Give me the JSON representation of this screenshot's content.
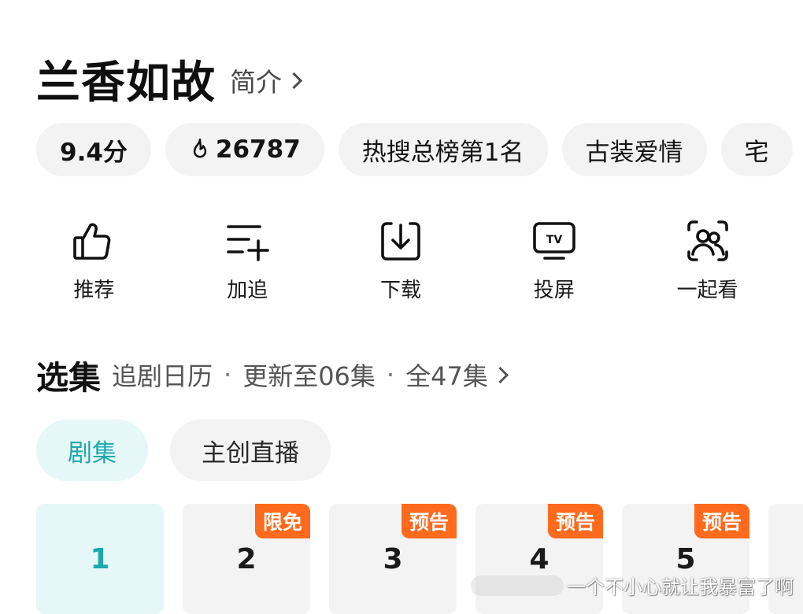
{
  "header": {
    "title": "兰香如故",
    "intro_label": "简介"
  },
  "tags": [
    {
      "label": "9.4分"
    },
    {
      "label": "26787",
      "icon": "flame-icon"
    },
    {
      "label": "热搜总榜第1名"
    },
    {
      "label": "古装爱情"
    },
    {
      "label": "宅"
    }
  ],
  "actions": [
    {
      "label": "推荐",
      "icon": "thumbs-up-icon"
    },
    {
      "label": "加追",
      "icon": "add-list-icon"
    },
    {
      "label": "下载",
      "icon": "download-icon"
    },
    {
      "label": "投屏",
      "icon": "tv-cast-icon"
    },
    {
      "label": "一起看",
      "icon": "watch-together-icon"
    }
  ],
  "episodes_section": {
    "title": "选集",
    "calendar_label": "追剧日历",
    "dot": "·",
    "update_label": "更新至06集",
    "total_label": "全47集"
  },
  "sub_tabs": [
    {
      "label": "剧集",
      "active": true
    },
    {
      "label": "主创直播",
      "active": false
    }
  ],
  "episodes": [
    {
      "number": "1",
      "badge": "",
      "selected": true
    },
    {
      "number": "2",
      "badge": "限免"
    },
    {
      "number": "3",
      "badge": "预告"
    },
    {
      "number": "4",
      "badge": "预告"
    },
    {
      "number": "5",
      "badge": "预告"
    }
  ],
  "colors": {
    "accent": "#1ea9ab",
    "accent_bg": "#e6f7f7",
    "badge": "#ff6a1c",
    "chip_bg": "#f3f3f3"
  },
  "watermark": {
    "text": "一个不小心就让我暴富了啊"
  }
}
